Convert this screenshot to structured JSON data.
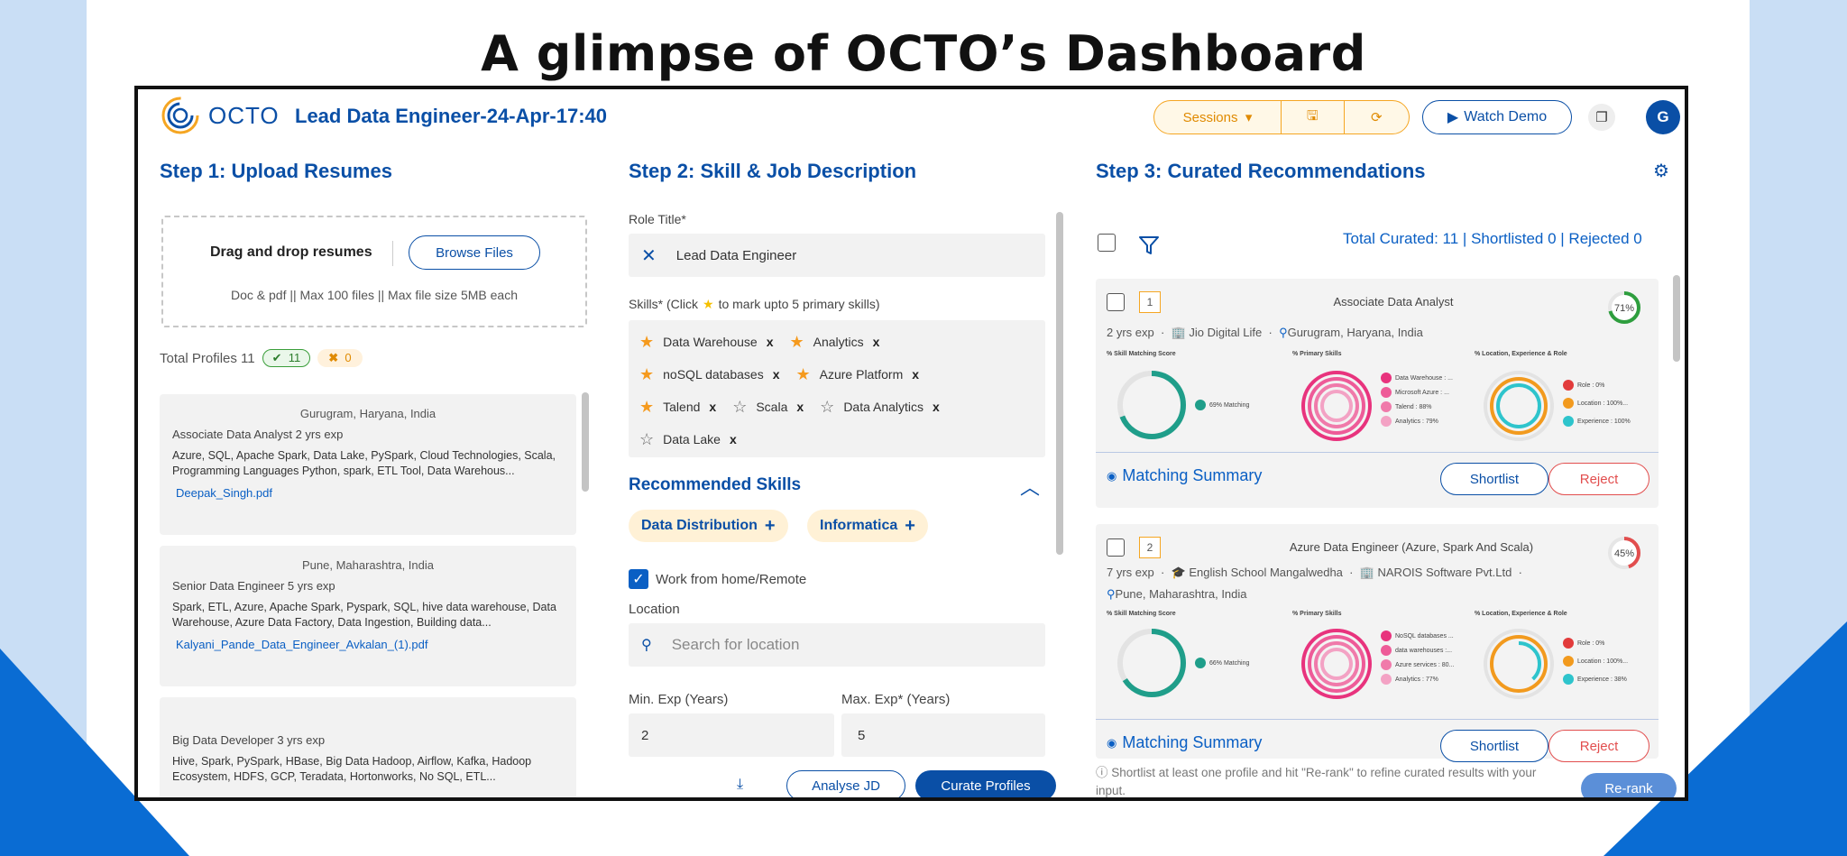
{
  "page_heading": "A glimpse of OCTO’s Dashboard",
  "header": {
    "logo_text": "OCTO",
    "role_title": "Lead Data Engineer-24-Apr-17:40",
    "sessions_label": "Sessions",
    "watch_demo_label": "Watch Demo",
    "avatar_initial": "G"
  },
  "step1": {
    "title": "Step 1: Upload Resumes",
    "drop_title": "Drag and drop resumes",
    "browse_label": "Browse Files",
    "drop_note": "Doc & pdf || Max 100 files || Max file size 5MB each",
    "total_profiles_label": "Total Profiles 11",
    "accepted_count": "11",
    "rejected_count": "0",
    "profiles": [
      {
        "location": "Gurugram, Haryana, India",
        "role": "Associate Data Analyst  2 yrs exp",
        "skills": "Azure, SQL, Apache Spark, Data Lake, PySpark, Cloud Technologies, Scala, Programming Languages Python, spark, ETL Tool, Data Warehous...",
        "file": "Deepak_Singh.pdf"
      },
      {
        "location": "Pune, Maharashtra, India",
        "role": "Senior Data Engineer  5 yrs exp",
        "skills": "Spark, ETL, Azure, Apache Spark, Pyspark, SQL, hive data warehouse, Data Warehouse, Azure Data Factory, Data Ingestion, Building data...",
        "file": "Kalyani_Pande_Data_Engineer_Avkalan_(1).pdf"
      },
      {
        "location": "",
        "role": "Big Data Developer  3 yrs exp",
        "skills": "Hive, Spark, PySpark, HBase, Big Data Hadoop, Airflow, Kafka, Hadoop Ecosystem, HDFS, GCP, Teradata, Hortonworks, No SQL, ETL...",
        "file": ""
      }
    ]
  },
  "step2": {
    "title": "Step 2: Skill & Job Description",
    "role_title_label": "Role Title*",
    "role_title_value": "Lead Data Engineer",
    "skills_label_pre": "Skills* (Click",
    "skills_label_post": "to mark upto 5 primary skills)",
    "skill_rows": [
      [
        {
          "name": "Data Warehouse",
          "primary": true
        },
        {
          "name": "Analytics",
          "primary": true
        }
      ],
      [
        {
          "name": "noSQL databases",
          "primary": true
        },
        {
          "name": "Azure Platform",
          "primary": true
        }
      ],
      [
        {
          "name": "Talend",
          "primary": true
        },
        {
          "name": "Scala",
          "primary": false
        },
        {
          "name": "Data Analytics",
          "primary": false
        }
      ],
      [
        {
          "name": "Data Lake",
          "primary": false
        }
      ]
    ],
    "recommended_title": "Recommended Skills",
    "recommended": [
      "Data Distribution",
      "Informatica"
    ],
    "wfh_label": "Work from home/Remote",
    "location_label": "Location",
    "location_placeholder": "Search for location",
    "min_exp_label": "Min. Exp (Years)",
    "max_exp_label": "Max. Exp* (Years)",
    "min_exp": "2",
    "max_exp": "5",
    "analyse_label": "Analyse JD",
    "curate_label": "Curate Profiles"
  },
  "step3": {
    "title": "Step 3: Curated Recommendations",
    "totals": "Total Curated: 11 | Shortlisted 0 | Rejected 0",
    "cards": [
      {
        "rank": "1",
        "title": "Associate Data Analyst",
        "score": "71%",
        "score_value": 71,
        "score_color": "#2e9e3e",
        "exp": "2 yrs exp",
        "company": "Jio Digital Life",
        "location": "Gurugram, Haryana, India",
        "school": "",
        "skill_match_text": "69% Matching",
        "skill_match": 69,
        "primary_legend": [
          "Data Warehouse : ...",
          "Microsoft Azure : ...",
          "Talend : 88%",
          "Analytics : 79%"
        ],
        "loc_legend": [
          "Role : 0%",
          "Location : 100%...",
          "Experience : 100%"
        ]
      },
      {
        "rank": "2",
        "title": "Azure Data Engineer (Azure, Spark And Scala)",
        "score": "45%",
        "score_value": 45,
        "score_color": "#e24e4e",
        "exp": "7 yrs exp",
        "school": "English School Mangalwedha",
        "company": "NAROIS Software Pvt.Ltd",
        "location": "Pune, Maharashtra, India",
        "skill_match_text": "66% Matching",
        "skill_match": 66,
        "primary_legend": [
          "NoSQL databases ...",
          "data warehouses :...",
          "Azure services : 80...",
          "Analytics : 77%"
        ],
        "loc_legend": [
          "Role : 0%",
          "Location : 100%...",
          "Experience : 38%"
        ]
      }
    ],
    "col_headers": [
      "% Skill Matching Score",
      "% Primary Skills",
      "% Location, Experience & Role"
    ],
    "matching_summary": "Matching Summary",
    "shortlist_label": "Shortlist",
    "reject_label": "Reject",
    "footer_note": "Shortlist at least one profile and hit \"Re-rank\" to refine curated results with your input.",
    "rerank_label": "Re-rank"
  }
}
